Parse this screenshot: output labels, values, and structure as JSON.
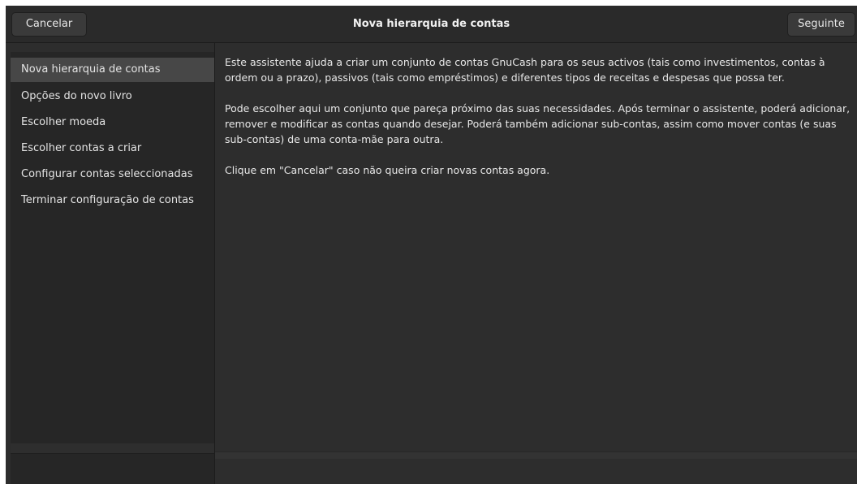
{
  "header": {
    "cancel_label": "Cancelar",
    "title": "Nova hierarquia de contas",
    "next_label": "Seguinte"
  },
  "sidebar": {
    "steps": [
      {
        "label": "Nova hierarquia de contas",
        "active": true
      },
      {
        "label": "Opções do novo livro",
        "active": false
      },
      {
        "label": "Escolher moeda",
        "active": false
      },
      {
        "label": "Escolher contas a criar",
        "active": false
      },
      {
        "label": "Configurar contas seleccionadas",
        "active": false
      },
      {
        "label": "Terminar configuração de contas",
        "active": false
      }
    ]
  },
  "content": {
    "paragraphs": [
      "Este assistente ajuda a criar um conjunto de contas GnuCash para os seus activos (tais como investimentos, contas à ordem ou a prazo), passivos (tais como empréstimos) e diferentes tipos de receitas e despesas que possa ter.",
      "Pode escolher aqui um conjunto que pareça próximo das suas necessidades. Após terminar o assistente, poderá adicionar, remover e modificar as contas quando desejar. Poderá também adicionar sub-contas, assim como mover contas (e suas sub-contas) de uma conta-mãe para outra.",
      "Clique em \"Cancelar\" caso não queira criar novas contas agora."
    ]
  },
  "colors": {
    "window_bg": "#2d2d2d",
    "sidebar_bg": "#262626",
    "active_step_bg": "#474747",
    "text": "#e8e8e8"
  }
}
